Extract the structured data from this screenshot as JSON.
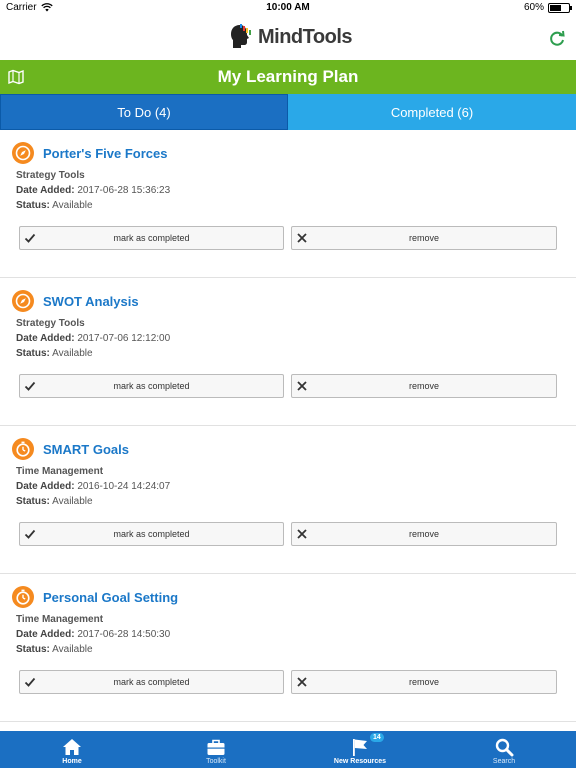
{
  "status_bar": {
    "carrier": "Carrier",
    "time": "10:00 AM",
    "battery": "60%",
    "battery_level": 0.6
  },
  "brand": {
    "logo_text": "MindTools"
  },
  "header": {
    "title": "My Learning Plan"
  },
  "tabs": [
    {
      "label": "To Do (4)",
      "active": true
    },
    {
      "label": "Completed (6)",
      "active": false
    }
  ],
  "labels": {
    "date_added": "Date Added:",
    "status": "Status:",
    "mark_completed": "mark as completed",
    "remove": "remove"
  },
  "items": [
    {
      "title": "Porter's Five Forces",
      "category": "Strategy Tools",
      "date_added": "2017-06-28 15:36:23",
      "status": "Available",
      "icon": "compass-icon"
    },
    {
      "title": "SWOT Analysis",
      "category": "Strategy Tools",
      "date_added": "2017-07-06 12:12:00",
      "status": "Available",
      "icon": "compass-icon"
    },
    {
      "title": "SMART Goals",
      "category": "Time Management",
      "date_added": "2016-10-24 14:24:07",
      "status": "Available",
      "icon": "stopwatch-icon"
    },
    {
      "title": "Personal Goal Setting",
      "category": "Time Management",
      "date_added": "2017-06-28 14:50:30",
      "status": "Available",
      "icon": "stopwatch-icon"
    }
  ],
  "bottom_nav": [
    {
      "label": "Home",
      "icon": "home-icon"
    },
    {
      "label": "Toolkit",
      "icon": "briefcase-icon"
    },
    {
      "label": "New Resources",
      "icon": "flag-icon",
      "badge": "14"
    },
    {
      "label": "Search",
      "icon": "search-icon"
    }
  ],
  "colors": {
    "green": "#6cb51f",
    "blue_active": "#1b6fc2",
    "blue_inactive": "#2aa8e8",
    "orange": "#f58a1f",
    "link_blue": "#1b78c8"
  }
}
